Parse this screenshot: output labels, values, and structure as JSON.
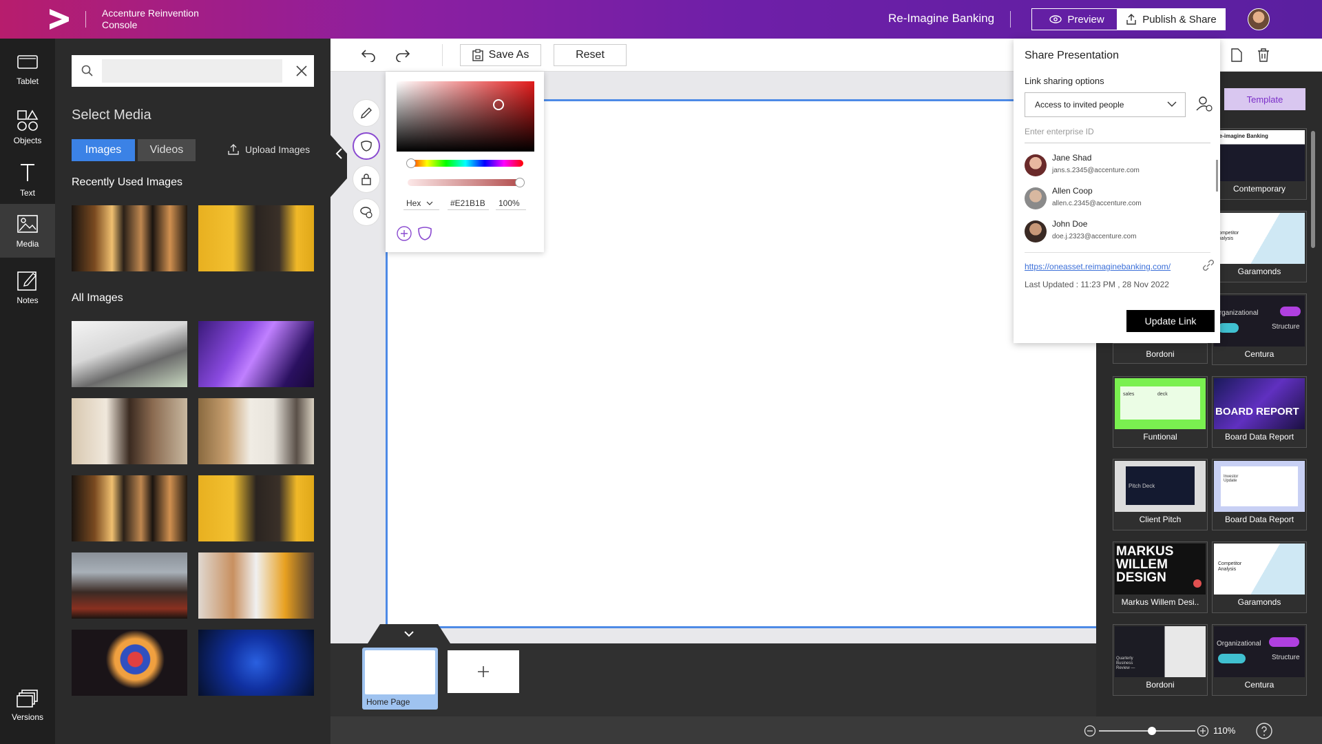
{
  "header": {
    "console_title": "Accenture Reinvention Console",
    "document_title": "Re-Imagine Banking",
    "preview_label": "Preview",
    "publish_label": "Publish & Share"
  },
  "rail": {
    "items": [
      {
        "label": "Tablet"
      },
      {
        "label": "Objects"
      },
      {
        "label": "Text"
      },
      {
        "label": "Media"
      },
      {
        "label": "Notes"
      }
    ],
    "versions_label": "Versions"
  },
  "media": {
    "search_placeholder": "",
    "heading": "Select Media",
    "tab_images": "Images",
    "tab_videos": "Videos",
    "upload_label": "Upload Images",
    "recent_title": "Recently Used Images",
    "all_title": "All Images"
  },
  "toolbar": {
    "save_as_label": "Save As",
    "reset_label": "Reset"
  },
  "color_picker": {
    "mode": "Hex",
    "hex_value": "#E21B1B",
    "opacity": "100%",
    "color": "#E21B1B"
  },
  "share": {
    "title": "Share Presentation",
    "subtitle": "Link sharing options",
    "access_option": "Access to invited people",
    "enterprise_placeholder": "Enter enterprise ID",
    "people": [
      {
        "name": "Jane Shad",
        "email": "jans.s.2345@accenture.com"
      },
      {
        "name": "Allen Coop",
        "email": "allen.c.2345@accenture.com"
      },
      {
        "name": "John Doe",
        "email": "doe.j.2323@accenture.com"
      }
    ],
    "link": "https://oneasset.reimaginebanking.com/",
    "last_updated": "Last Updated : 11:23 PM , 28 Nov 2022",
    "update_button": "Update Link"
  },
  "templates": {
    "tab_label": "Template",
    "cards": [
      {
        "label": "Contemporary"
      },
      {
        "label": "Garamonds"
      },
      {
        "label": "Bordoni"
      },
      {
        "label": "Centura"
      },
      {
        "label": "Funtional"
      },
      {
        "label": "Board Data Report"
      },
      {
        "label": "Client Pitch"
      },
      {
        "label": "Board Data Report"
      },
      {
        "label": "Markus Willem Desi.."
      },
      {
        "label": "Garamonds"
      },
      {
        "label": "Bordoni"
      },
      {
        "label": "Centura"
      }
    ],
    "thumb_text": {
      "reimagine": "Re-imagine Banking",
      "competitor": "Competitor Analysis",
      "org": "Organizational",
      "structure": "Structure",
      "sales": "sales",
      "deck": "deck",
      "board_report": "BOARD REPORT",
      "pitch_deck": "Pitch Deck",
      "investor": "Investor Update",
      "markus": "MARKUS WILLEM DESIGN",
      "quarterly": "Quarterly Business Review —"
    }
  },
  "filmstrip": {
    "page_label": "Home Page"
  },
  "status": {
    "zoom": "110%",
    "zoom_fraction": 0.55
  }
}
